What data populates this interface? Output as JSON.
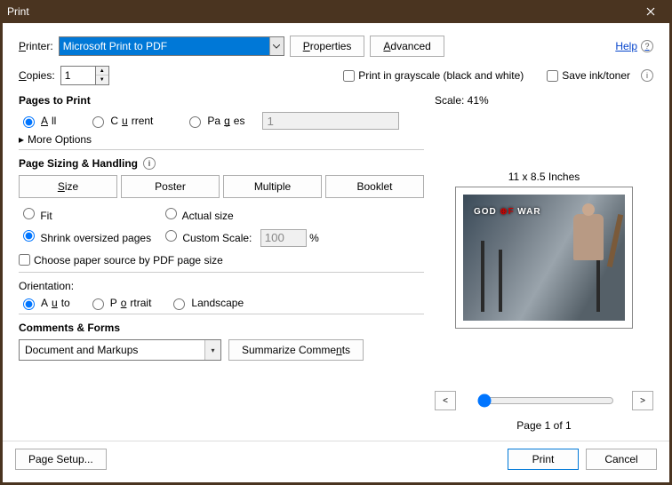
{
  "window": {
    "title": "Print"
  },
  "toprow": {
    "printer_label": "Printer:",
    "printer_value": "Microsoft Print to PDF",
    "properties_btn": "Properties",
    "advanced_btn": "Advanced",
    "help": "Help"
  },
  "row2": {
    "copies_label": "Copies:",
    "copies_value": "1",
    "grayscale_label": "Print in grayscale (black and white)",
    "saveink_label": "Save ink/toner"
  },
  "pages": {
    "title": "Pages to Print",
    "all": "All",
    "current": "Current",
    "pages": "Pages",
    "pages_value": "1",
    "more": "More Options"
  },
  "sizing": {
    "title": "Page Sizing & Handling",
    "size_btn": "Size",
    "poster_btn": "Poster",
    "multiple_btn": "Multiple",
    "booklet_btn": "Booklet",
    "fit": "Fit",
    "actual": "Actual size",
    "shrink": "Shrink oversized pages",
    "custom": "Custom Scale:",
    "custom_value": "100",
    "custom_pct": "%",
    "choose_paper": "Choose paper source by PDF page size"
  },
  "orientation": {
    "title": "Orientation:",
    "auto": "Auto",
    "portrait": "Portrait",
    "landscape": "Landscape"
  },
  "comments": {
    "title": "Comments & Forms",
    "dropdown_value": "Document and Markups",
    "summarize_btn": "Summarize Comments"
  },
  "preview": {
    "scale_label": "Scale:  41%",
    "paper_dim": "11 x 8.5 Inches",
    "game_title_1": "GOD",
    "game_title_2": "WAR",
    "page_of": "Page 1 of 1"
  },
  "footer": {
    "page_setup": "Page Setup...",
    "print": "Print",
    "cancel": "Cancel"
  }
}
